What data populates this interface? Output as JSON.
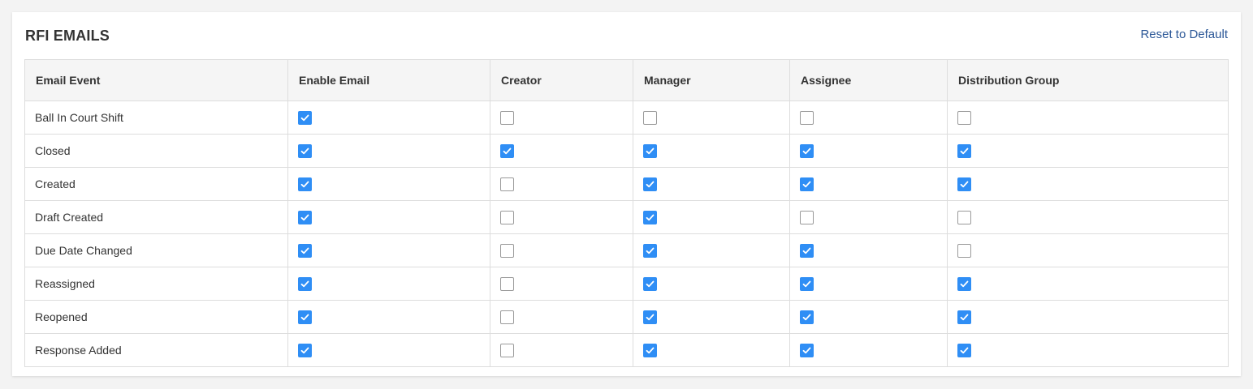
{
  "section": {
    "title": "RFI EMAILS",
    "reset_label": "Reset to Default"
  },
  "table": {
    "columns": [
      "Email Event",
      "Enable Email",
      "Creator",
      "Manager",
      "Assignee",
      "Distribution Group"
    ],
    "rows": [
      {
        "event": "Ball In Court Shift",
        "enable": true,
        "creator": false,
        "manager": false,
        "assignee": false,
        "distribution": false
      },
      {
        "event": "Closed",
        "enable": true,
        "creator": true,
        "manager": true,
        "assignee": true,
        "distribution": true
      },
      {
        "event": "Created",
        "enable": true,
        "creator": false,
        "manager": true,
        "assignee": true,
        "distribution": true
      },
      {
        "event": "Draft Created",
        "enable": true,
        "creator": false,
        "manager": true,
        "assignee": false,
        "distribution": false
      },
      {
        "event": "Due Date Changed",
        "enable": true,
        "creator": false,
        "manager": true,
        "assignee": true,
        "distribution": false
      },
      {
        "event": "Reassigned",
        "enable": true,
        "creator": false,
        "manager": true,
        "assignee": true,
        "distribution": true
      },
      {
        "event": "Reopened",
        "enable": true,
        "creator": false,
        "manager": true,
        "assignee": true,
        "distribution": true
      },
      {
        "event": "Response Added",
        "enable": true,
        "creator": false,
        "manager": true,
        "assignee": true,
        "distribution": true
      }
    ]
  },
  "colors": {
    "checkbox_checked": "#2f8ef5",
    "link": "#2b5797"
  }
}
